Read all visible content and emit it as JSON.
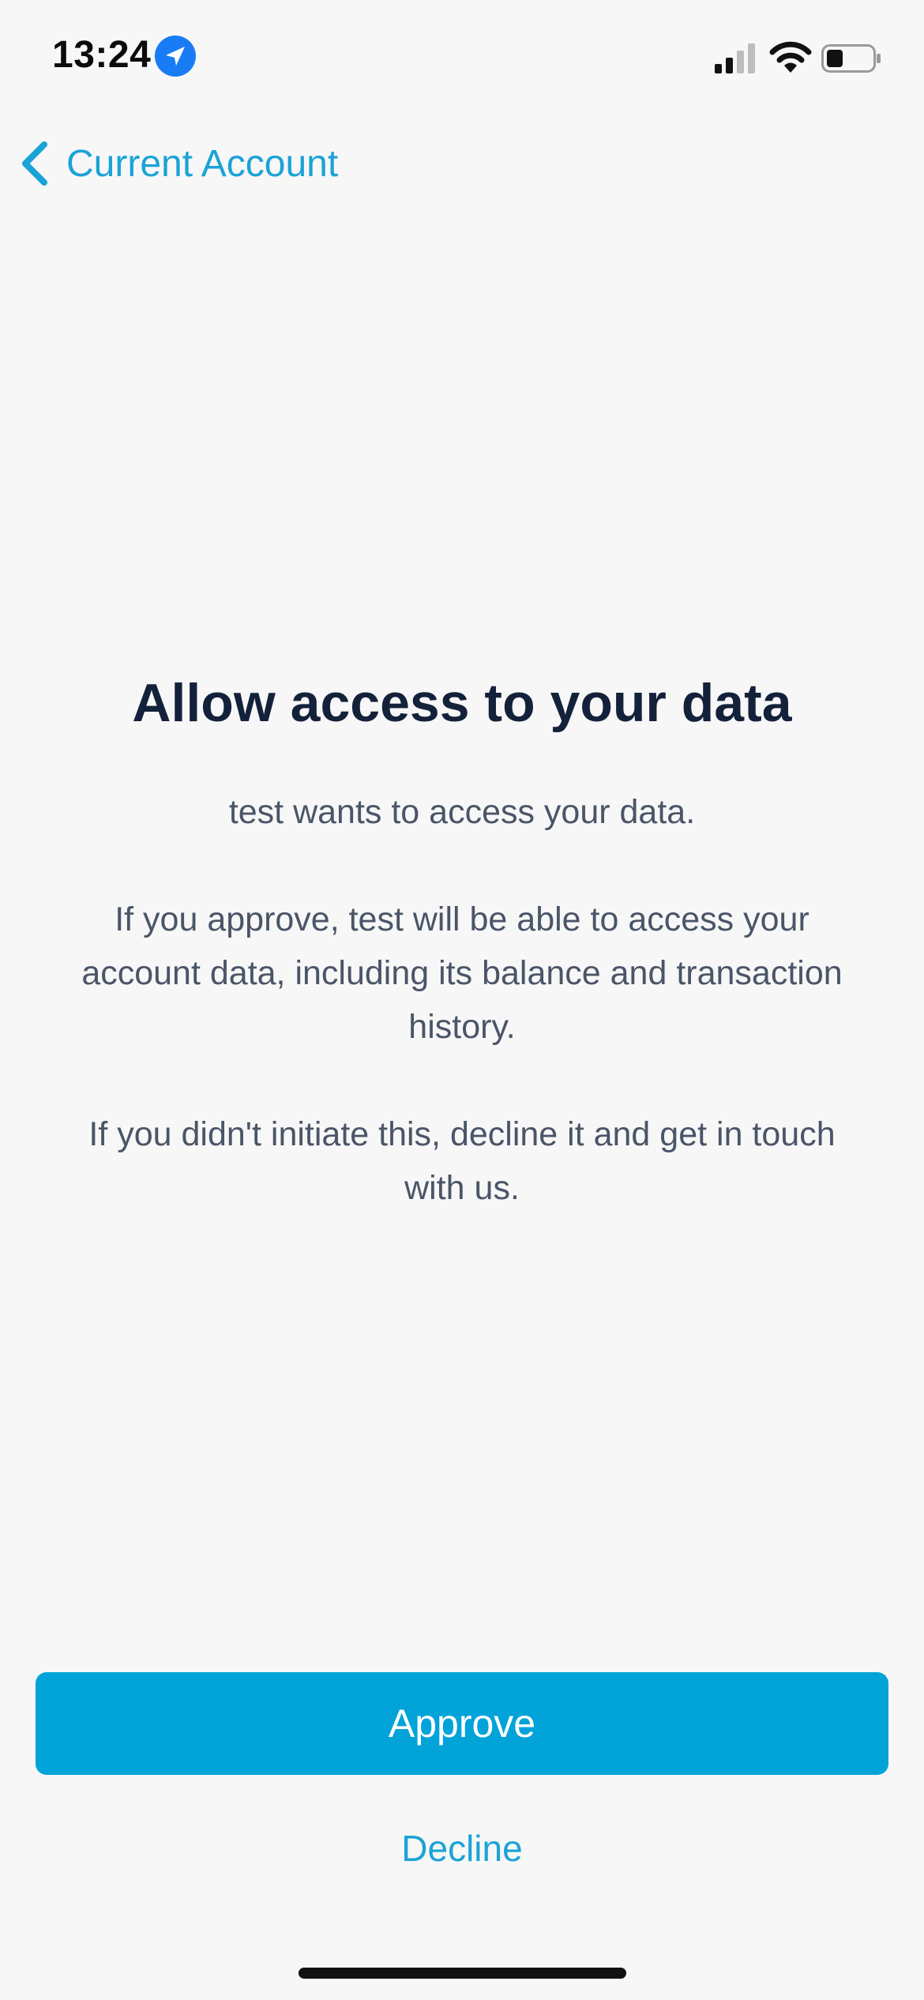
{
  "status_bar": {
    "time": "13:24",
    "location_icon": "location-arrow-icon",
    "signal_icon": "cellular-signal-icon",
    "wifi_icon": "wifi-icon",
    "battery_icon": "battery-icon",
    "battery_level": 0.35,
    "accent_color": "#1a7cf4"
  },
  "nav": {
    "back_label": "Current Account",
    "back_icon": "chevron-left-icon"
  },
  "content": {
    "title": "Allow access to your data",
    "paragraph_1": "test wants to access your data.",
    "paragraph_2": "If you approve, test will be able to access your account data, including its balance and transaction history.",
    "paragraph_3": "If you didn't initiate this, decline it and get in touch with us."
  },
  "actions": {
    "approve_label": "Approve",
    "decline_label": "Decline"
  },
  "colors": {
    "accent": "#02a3d9",
    "link": "#1aa3d6",
    "title": "#14213a",
    "body_text": "#4a5568",
    "background": "#f7f7f7"
  }
}
